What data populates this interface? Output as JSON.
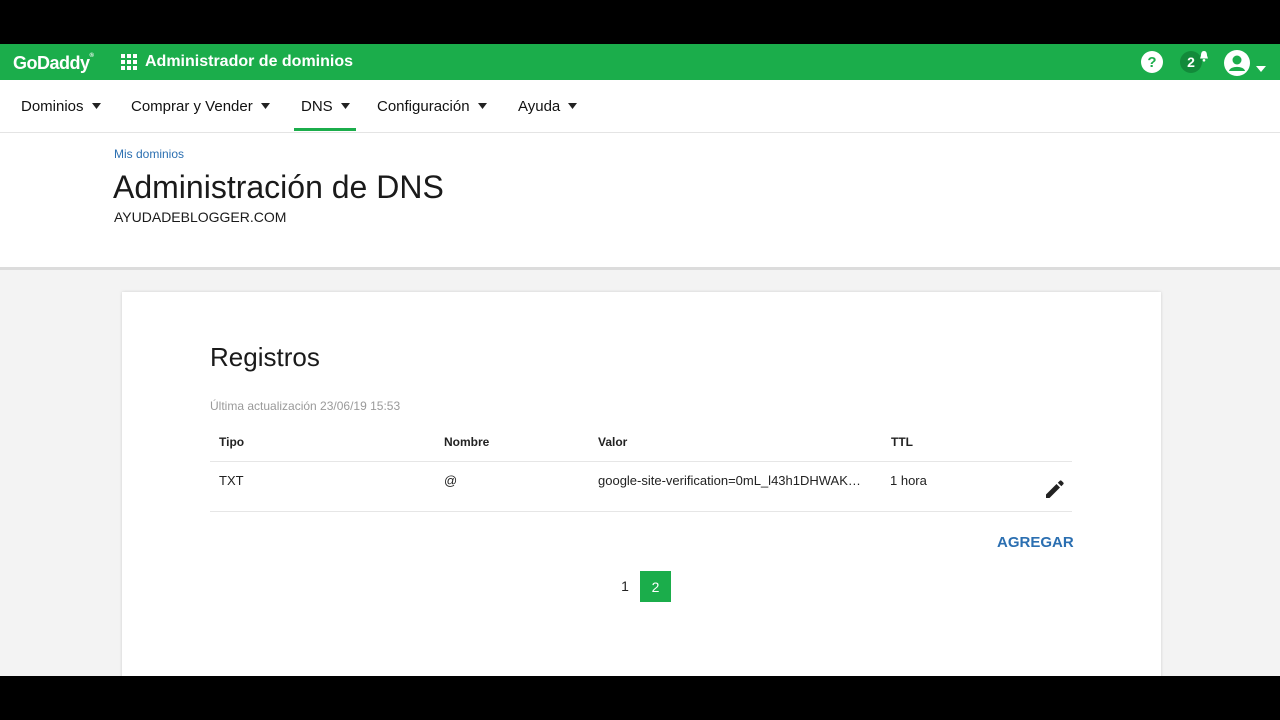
{
  "topbar": {
    "logo_text": "GoDaddy",
    "logo_mark": "®",
    "app_title": "Administrador de dominios",
    "notifications_count": "2",
    "icons": [
      "apps-grid-icon",
      "help-icon",
      "bell-icon",
      "avatar-icon",
      "caret-down-icon"
    ]
  },
  "nav": {
    "items": [
      {
        "label": "Dominios"
      },
      {
        "label": "Comprar y Vender"
      },
      {
        "label": "DNS"
      },
      {
        "label": "Configuración"
      },
      {
        "label": "Ayuda"
      }
    ],
    "active": "DNS"
  },
  "header": {
    "breadcrumb": "Mis dominios",
    "title": "Administración de DNS",
    "domain": "AYUDADEBLOGGER.COM"
  },
  "records": {
    "title": "Registros",
    "last_update": "Última actualización 23/06/19 15:53",
    "columns": [
      "Tipo",
      "Nombre",
      "Valor",
      "TTL"
    ],
    "rows": [
      {
        "tipo": "TXT",
        "nombre": "@",
        "valor": "google-site-verification=0mL_l43h1DHWAK…",
        "ttl": "1 hora"
      }
    ],
    "add_label": "AGREGAR",
    "pages": [
      "1",
      "2"
    ],
    "current_page": "2"
  },
  "colors": {
    "brand_green": "#1bad4b",
    "link_blue": "#2b6fb1"
  }
}
